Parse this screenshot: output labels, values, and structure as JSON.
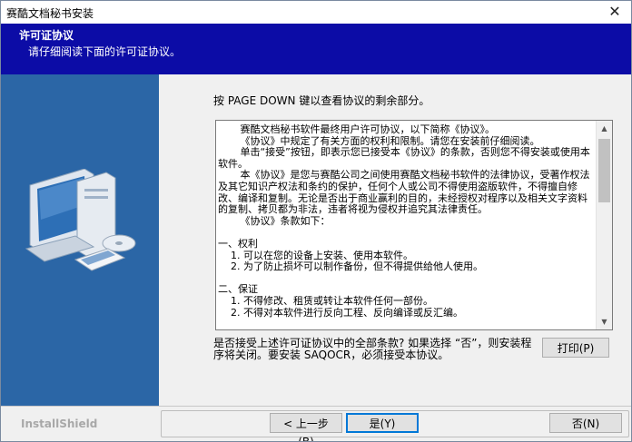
{
  "window": {
    "title": "赛酷文档秘书安装",
    "close_glyph": "✕"
  },
  "banner": {
    "heading": "许可证协议",
    "subheading": "请仔细阅读下面的许可证协议。"
  },
  "content": {
    "hint": "按 PAGE DOWN 键以查看协议的剩余部分。",
    "license_text": "       赛酷文档秘书软件最终用户许可协议，以下简称《协议》。\n       《协议》中规定了有关方面的权利和限制。请您在安装前仔细阅读。\n       单击“接受”按钮，即表示您已接受本《协议》的条款，否则您不得安装或使用本软件。\n       本《协议》是您与赛酷公司之间使用赛酷文档秘书软件的法律协议，受著作权法及其它知识产权法和条约的保护，任何个人或公司不得使用盗版软件，不得擅自修改、编译和复制。无论是否出于商业赢利的目的，未经授权对程序以及相关文字资料的复制、拷贝都为非法，违者将视为侵权并追究其法律责任。\n       《协议》条款如下：\n\n一、权利\n    1. 可以在您的设备上安装、使用本软件。\n    2. 为了防止损坏可以制作备份，但不得提供给他人使用。\n\n二、保证\n    1. 不得修改、租赁或转让本软件任何一部份。\n    2. 不得对本软件进行反向工程、反向编译或反汇编。",
    "question": "是否接受上述许可证协议中的全部条款? 如果选择 “否”，则安装程序将关闭。要安装 SAQOCR，必须接受本协议。",
    "print_label": "打印(P)"
  },
  "footer": {
    "brand": "InstallShield",
    "back_label": "< 上一步(B)",
    "yes_label": "是(Y)",
    "no_label": "否(N)"
  },
  "scrollbar": {
    "up_glyph": "▲",
    "down_glyph": "▼"
  }
}
